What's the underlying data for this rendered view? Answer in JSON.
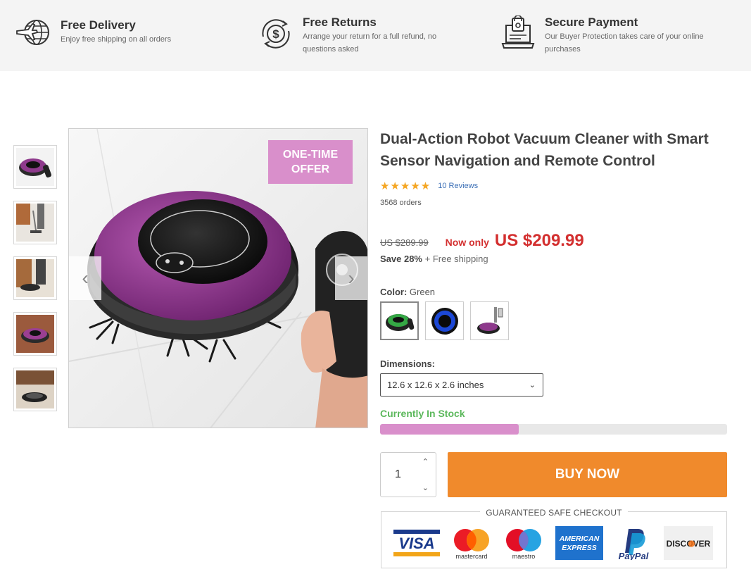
{
  "features": [
    {
      "title": "Free Delivery",
      "desc": "Enjoy free shipping on all orders",
      "icon": "delivery-globe-icon"
    },
    {
      "title": "Free Returns",
      "desc_lines": [
        "Arrange your return for a full refund, no",
        "questions asked"
      ],
      "icon": "refund-dollar-icon"
    },
    {
      "title": "Secure Payment",
      "desc_lines": [
        "Our Buyer Protection takes care of your online",
        "purchases"
      ],
      "icon": "secure-laptop-icon"
    }
  ],
  "gallery": {
    "offer_lines": [
      "ONE-TIME",
      "OFFER"
    ],
    "prev_icon": "chevron-left-icon",
    "next_icon": "chevron-right-icon"
  },
  "product": {
    "title": "Dual-Action Robot Vacuum Cleaner with Smart Sensor Navigation and Remote Control",
    "stars": "★★★★★",
    "reviews": "10 Reviews",
    "orders": "3568 orders",
    "old_price": "US $289.99",
    "now_only": "Now only",
    "price": "US $209.99",
    "save": "Save 28%",
    "shipping": "+ Free shipping",
    "color_label": "Color:",
    "color_value": "Green",
    "dimensions_label": "Dimensions:",
    "dimensions_value": "12.6 x 12.6 x 2.6 inches",
    "stock_label": "Currently In Stock",
    "stock_level": 0.4,
    "quantity": "1",
    "buy_label": "BUY NOW"
  },
  "checkout": {
    "title": "GUARANTEED SAFE CHECKOUT",
    "visa": "VISA",
    "mastercard": "mastercard",
    "maestro": "maestro",
    "amex_lines": [
      "AMERICAN",
      "EXPRESS"
    ],
    "paypal": "PayPal",
    "discover": "DISCOVER"
  },
  "colors": {
    "accent_pink": "#d98fcb",
    "buy_orange": "#f08a2c",
    "price_red": "#d32f2f",
    "stock_green": "#5cb85c"
  }
}
